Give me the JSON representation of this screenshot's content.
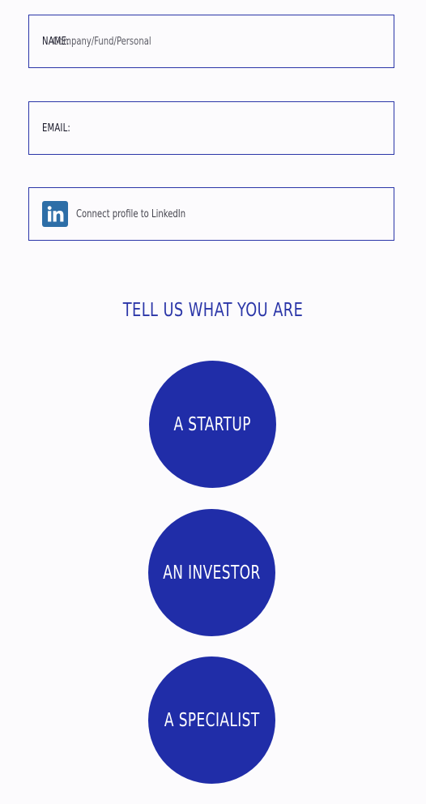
{
  "form": {
    "name_label": "NAME:",
    "name_placeholder": "Company/Fund/Personal",
    "email_label": "EMAIL:",
    "email_placeholder": "",
    "linkedin_text": "Connect profile to LinkedIn",
    "linkedin_icon": "linkedin-icon"
  },
  "section": {
    "title": "TELL US WHAT YOU ARE"
  },
  "roles": {
    "startup": "A STARTUP",
    "investor": "AN INVESTOR",
    "specialist": "A SPECIALIST"
  },
  "colors": {
    "accent": "#202da8",
    "border": "#2b36a8",
    "linkedin": "#2d6ea7",
    "background": "#fcfbfd"
  }
}
